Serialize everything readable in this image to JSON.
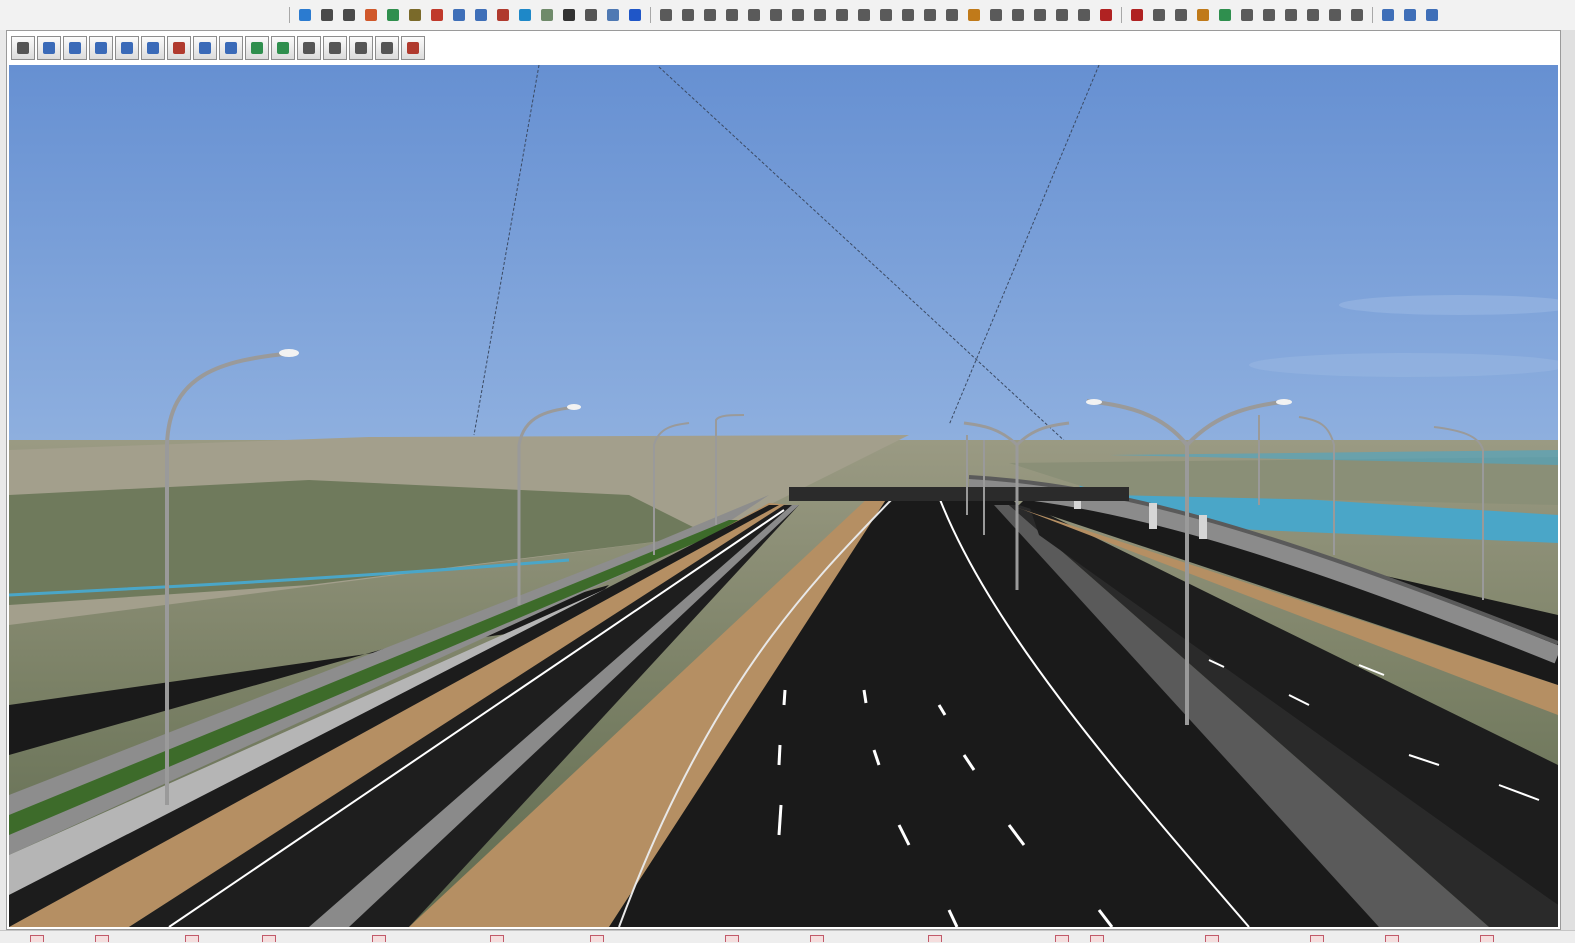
{
  "main_toolbar": {
    "groups": [
      {
        "name": "view",
        "buttons": [
          {
            "icon": "globe-icon",
            "color": "#2b7bd0"
          },
          {
            "icon": "network-icon",
            "color": "#4a4a4a"
          },
          {
            "icon": "network-alt-icon",
            "color": "#4a4a4a"
          },
          {
            "icon": "sphere-icon",
            "color": "#d0582b"
          },
          {
            "icon": "earth-icon",
            "color": "#2f8f4e"
          },
          {
            "icon": "route-icon",
            "color": "#7a6a2a"
          },
          {
            "icon": "pen-icon",
            "color": "#c0392b"
          },
          {
            "icon": "chart-icon",
            "color": "#3f6fb8"
          },
          {
            "icon": "chart-alt-icon",
            "color": "#3f6fb8"
          },
          {
            "icon": "cut-icon",
            "color": "#b03a2e"
          },
          {
            "icon": "globe-blue-icon",
            "color": "#1e88c8"
          },
          {
            "icon": "frame-icon",
            "color": "#6f8a6a"
          },
          {
            "icon": "clock-icon",
            "color": "#333333"
          },
          {
            "icon": "text-icon",
            "color": "#555555"
          },
          {
            "icon": "image-icon",
            "color": "#4f79b3"
          },
          {
            "icon": "help-icon",
            "color": "#1f56c8"
          }
        ]
      },
      {
        "name": "edit",
        "buttons": [
          {
            "icon": "pencil-icon",
            "color": "#5a5a5a"
          },
          {
            "icon": "profile-icon",
            "color": "#5a5a5a"
          },
          {
            "icon": "curve-icon",
            "color": "#5a5a5a"
          },
          {
            "icon": "curve-edit-icon",
            "color": "#5a5a5a"
          },
          {
            "icon": "curve-plus-icon",
            "color": "#5a5a5a"
          },
          {
            "icon": "lines-icon",
            "color": "#5a5a5a"
          },
          {
            "icon": "check-curve-icon",
            "color": "#5a5a5a"
          },
          {
            "icon": "arc-icon",
            "color": "#5a5a5a"
          },
          {
            "icon": "arc-right-icon",
            "color": "#5a5a5a"
          },
          {
            "icon": "zigzag-icon",
            "color": "#5a5a5a"
          },
          {
            "icon": "table-icon",
            "color": "#5a5a5a"
          },
          {
            "icon": "table-alt-icon",
            "color": "#5a5a5a"
          },
          {
            "icon": "wave-icon",
            "color": "#5a5a5a"
          },
          {
            "icon": "person-icon",
            "color": "#5a5a5a"
          },
          {
            "icon": "level-icon",
            "color": "#c07a1a"
          },
          {
            "icon": "marker-icon",
            "color": "#5a5a5a"
          },
          {
            "icon": "document-icon",
            "color": "#5a5a5a"
          },
          {
            "icon": "person-alt-icon",
            "color": "#5a5a5a"
          },
          {
            "icon": "report-icon",
            "color": "#5a5a5a"
          },
          {
            "icon": "calendar-icon",
            "color": "#5a5a5a"
          },
          {
            "icon": "question-icon",
            "color": "#b02222"
          }
        ]
      },
      {
        "name": "design",
        "buttons": [
          {
            "icon": "cross-section-icon",
            "color": "#b02222"
          },
          {
            "icon": "grid-icon",
            "color": "#5a5a5a"
          },
          {
            "icon": "list-icon",
            "color": "#5a5a5a"
          },
          {
            "icon": "slope-icon",
            "color": "#c07a1a"
          },
          {
            "icon": "layers-icon",
            "color": "#2f8f4e"
          },
          {
            "icon": "fill-icon",
            "color": "#5a5a5a"
          },
          {
            "icon": "lane-icon",
            "color": "#5a5a5a"
          },
          {
            "icon": "table-grid-icon",
            "color": "#5a5a5a"
          },
          {
            "icon": "nodes-icon",
            "color": "#5a5a5a"
          },
          {
            "icon": "nodes-alt-icon",
            "color": "#5a5a5a"
          },
          {
            "icon": "tag-icon",
            "color": "#5a5a5a"
          }
        ]
      },
      {
        "name": "zoom",
        "buttons": [
          {
            "icon": "zoom-icon",
            "color": "#3f6fb8"
          },
          {
            "icon": "zoom-in-icon",
            "color": "#3f6fb8"
          },
          {
            "icon": "zoom-fit-icon",
            "color": "#3f6fb8"
          }
        ]
      }
    ]
  },
  "view_toolbar": {
    "buttons": [
      {
        "icon": "window-icon",
        "color": "#555555"
      },
      {
        "icon": "plus-icon",
        "color": "#3a6ab8"
      },
      {
        "icon": "minus-icon",
        "color": "#3a6ab8"
      },
      {
        "icon": "zoom-in-icon",
        "color": "#3a6ab8"
      },
      {
        "icon": "pan-icon",
        "color": "#3a6ab8"
      },
      {
        "icon": "zoom-window-icon",
        "color": "#3a6ab8"
      },
      {
        "icon": "zoom-extent-icon",
        "color": "#b03a2e"
      },
      {
        "icon": "zoom-out-icon",
        "color": "#3a6ab8"
      },
      {
        "icon": "rotate-icon",
        "color": "#3a6ab8"
      },
      {
        "icon": "fly-icon",
        "color": "#2f8f4e"
      },
      {
        "icon": "leaf-icon",
        "color": "#2f8f4e"
      },
      {
        "icon": "walk-icon",
        "color": "#555555"
      },
      {
        "icon": "drive-icon",
        "color": "#555555"
      },
      {
        "icon": "steering-icon",
        "color": "#555555"
      },
      {
        "icon": "measure-icon",
        "color": "#555555"
      },
      {
        "icon": "print-icon",
        "color": "#b03a2e"
      }
    ]
  },
  "scene": {
    "sky_color": "#6f97d6",
    "ground_color": "#7d8467",
    "road_color": "#1c1c1c",
    "median_color": "#c8a478",
    "water_color": "#4aa6c8",
    "grass_color": "#3d6b2a"
  }
}
